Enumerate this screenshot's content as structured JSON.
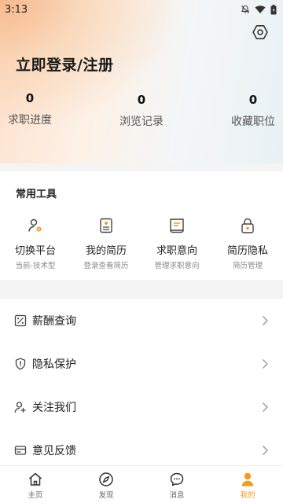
{
  "status_bar": {
    "time": "3:13"
  },
  "header": {
    "login_text": "立即登录/注册"
  },
  "stats": [
    {
      "count": "0",
      "label": "求职进度"
    },
    {
      "count": "0",
      "label": "浏览记录"
    },
    {
      "count": "0",
      "label": "收藏职位"
    }
  ],
  "tools": {
    "title": "常用工具",
    "items": [
      {
        "label": "切换平台",
        "sub": "当前-技术型",
        "icon": "user-switch-icon"
      },
      {
        "label": "我的简历",
        "sub": "登录查看简历",
        "icon": "resume-icon"
      },
      {
        "label": "求职意向",
        "sub": "管理求职意向",
        "icon": "job-intent-icon"
      },
      {
        "label": "简历隐私",
        "sub": "简历管理",
        "icon": "lock-icon"
      }
    ]
  },
  "menu": [
    {
      "label": "薪酬查询",
      "icon": "salary-icon"
    },
    {
      "label": "隐私保护",
      "icon": "shield-icon"
    },
    {
      "label": "关注我们",
      "icon": "add-user-icon"
    },
    {
      "label": "意见反馈",
      "icon": "feedback-icon"
    }
  ],
  "tabbar": [
    {
      "label": "主页",
      "icon": "home-icon"
    },
    {
      "label": "发现",
      "icon": "compass-icon"
    },
    {
      "label": "消息",
      "icon": "message-icon"
    },
    {
      "label": "我的",
      "icon": "person-icon",
      "active": true
    }
  ],
  "colors": {
    "accent": "#f39a1f",
    "icon_gray": "#444444"
  }
}
